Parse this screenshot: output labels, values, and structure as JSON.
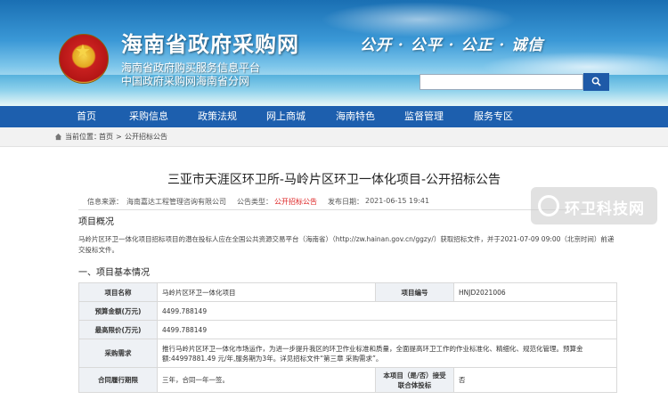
{
  "header": {
    "site_title": "海南省政府采购网",
    "subtitle_1": "海南省政府购买服务信息平台",
    "subtitle_2": "中国政府采购网海南省分网",
    "slogan": "公开 · 公平 · 公正 · 诚信",
    "search_placeholder": "",
    "search_icon": "search-icon"
  },
  "nav": {
    "items": [
      {
        "label": "首页"
      },
      {
        "label": "采购信息"
      },
      {
        "label": "政策法规"
      },
      {
        "label": "网上商城"
      },
      {
        "label": "海南特色"
      },
      {
        "label": "监督管理"
      },
      {
        "label": "服务专区"
      }
    ]
  },
  "breadcrumb": {
    "prefix": "当前位置：",
    "home": "首页",
    "sep": ">",
    "current": "公开招标公告"
  },
  "article": {
    "title": "三亚市天涯区环卫所-马岭片区环卫一体化项目-公开招标公告",
    "source_label": "信息来源：",
    "source_value": "海南嘉达工程管理咨询有限公司",
    "type_label": "公告类型：",
    "type_value": "公开招标公告",
    "date_label": "发布日期：",
    "date_value": "2021-06-15 19:41",
    "overview_heading": "项目概况",
    "overview_text": "马岭片区环卫一体化项目招标项目的潜在投标人应在全国公共资源交易平台（海南省）（http://zw.hainan.gov.cn/ggzy/）获取招标文件，并于2021-07-09 09:00（北京时间）前递交投标文件。",
    "section1_heading": "一、项目基本情况",
    "table": {
      "project_name_label": "项目名称",
      "project_name": "马岭片区环卫一体化项目",
      "project_no_label": "项目编号",
      "project_no": "HNJD2021006",
      "budget_label": "预算金额(万元)",
      "budget": "4499.788149",
      "max_price_label": "最高限价(万元)",
      "max_price": "4499.788149",
      "demand_label": "采购需求",
      "demand": "推行马岭片区环卫一体化市场运作，为进一步提升我区的环卫作业标准和质量，全面提高环卫工作的作业标准化、精细化、规范化管理。预算金额:44997881.49 元/年,服务期为3年。详见招标文件“第三章 采购需求”。",
      "contract_label": "合同履行期限",
      "contract": "三年，合同一年一签。",
      "consortium_label": "本项目（是/否）接受联合体投标",
      "consortium": "否"
    }
  },
  "watermark": {
    "text": "环卫科技网"
  },
  "colors": {
    "nav_bg": "#1d5fae",
    "accent_red": "#d22222",
    "label_bg": "#eef1f5"
  }
}
